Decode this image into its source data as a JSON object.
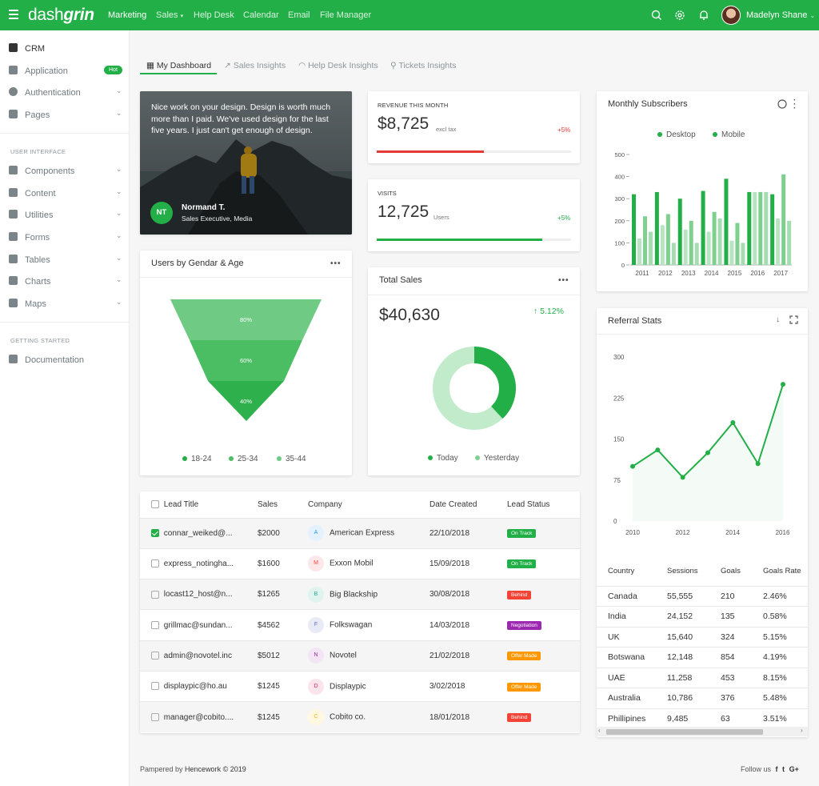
{
  "app": {
    "logo_light": "dash",
    "logo_bold": "grin"
  },
  "topnav": {
    "items": [
      {
        "label": "Marketing",
        "active": true
      },
      {
        "label": "Sales",
        "caret": "▾"
      },
      {
        "label": "Help Desk"
      },
      {
        "label": "Calendar"
      },
      {
        "label": "Email"
      },
      {
        "label": "File Manager"
      }
    ],
    "user_name": "Madelyn Shane",
    "user_caret": "⌄"
  },
  "sidebar": {
    "items": [
      {
        "label": "CRM",
        "icon": "chart-icon",
        "active": true
      },
      {
        "label": "Application",
        "icon": "app-icon",
        "badge": "Hot"
      },
      {
        "label": "Authentication",
        "icon": "user-icon",
        "chevron": "⌄"
      },
      {
        "label": "Pages",
        "icon": "page-icon",
        "chevron": "⌄"
      }
    ],
    "section_ui": "USER INTERFACE",
    "ui_items": [
      {
        "label": "Components",
        "icon": "components-icon",
        "chevron": "⌄"
      },
      {
        "label": "Content",
        "icon": "content-icon",
        "chevron": "⌄"
      },
      {
        "label": "Utilities",
        "icon": "utilities-icon",
        "chevron": "⌄"
      },
      {
        "label": "Forms",
        "icon": "forms-icon",
        "chevron": "⌄"
      },
      {
        "label": "Tables",
        "icon": "tables-icon",
        "chevron": "⌄"
      },
      {
        "label": "Charts",
        "icon": "charts-icon",
        "chevron": "⌄"
      },
      {
        "label": "Maps",
        "icon": "maps-icon",
        "chevron": "⌄"
      }
    ],
    "section_start": "GETTING STARTED",
    "start_items": [
      {
        "label": "Documentation",
        "icon": "book-icon"
      }
    ]
  },
  "tabs": [
    {
      "label": "My Dashboard",
      "active": true
    },
    {
      "label": "Sales Insights"
    },
    {
      "label": "Help Desk Insights"
    },
    {
      "label": "Tickets Insights"
    }
  ],
  "testimonial": {
    "quote": "Nice work on your design. Design is worth much more than I paid. We've used design for the last five years. I just can't get enough of design.",
    "initials": "NT",
    "name": "Normand T.",
    "role": "Sales Executive, Media"
  },
  "revenue": {
    "label": "REVENUE THIS MONTH",
    "value": "$8,725",
    "unit": "excl tax",
    "change": "+5%",
    "progress": 0.55
  },
  "visits": {
    "label": "VISITS",
    "value": "12,725",
    "unit": "Users",
    "change": "+5%",
    "progress": 0.85
  },
  "funnel": {
    "title": "Users by Gendar & Age",
    "more": "•••",
    "levels": [
      "80%",
      "60%",
      "40%"
    ],
    "legend": [
      "18-24",
      "25-34",
      "35-44"
    ]
  },
  "total_sales": {
    "title": "Total Sales",
    "more": "•••",
    "value": "$40,630",
    "change": "5.12%",
    "change_arrow": "↑",
    "legend": [
      "Today",
      "Yesterday"
    ],
    "today_share": 0.38
  },
  "leads": {
    "headers": [
      "Lead Title",
      "Sales",
      "Company",
      "Date Created",
      "Lead Status"
    ],
    "rows": [
      {
        "title": "connar_weiked@...",
        "sales": "$2000",
        "initial": "A",
        "company": "American Express",
        "date": "22/10/2018",
        "status": "On Track",
        "checked": true
      },
      {
        "title": "express_notingha...",
        "sales": "$1600",
        "initial": "M",
        "company": "Exxon Mobil",
        "date": "15/09/2018",
        "status": "On Track"
      },
      {
        "title": "locast12_host@n...",
        "sales": "$1265",
        "initial": "B",
        "company": "Big Blackship",
        "date": "30/08/2018",
        "status": "Behind"
      },
      {
        "title": "grillmac@sundan...",
        "sales": "$4562",
        "initial": "F",
        "company": "Folkswagan",
        "date": "14/03/2018",
        "status": "Negotiation"
      },
      {
        "title": "admin@novotel.inc",
        "sales": "$5012",
        "initial": "N",
        "company": "Novotel",
        "date": "21/02/2018",
        "status": "Offer Made"
      },
      {
        "title": "displaypic@ho.au",
        "sales": "$1245",
        "initial": "D",
        "company": "Displaypic",
        "date": "3/02/2018",
        "status": "Offer Made"
      },
      {
        "title": "manager@cobito....",
        "sales": "$1245",
        "initial": "C",
        "company": "Cobito co.",
        "date": "18/01/2018",
        "status": "Behind"
      }
    ]
  },
  "status_colors": {
    "On Track": "#22af47",
    "Behind": "#f44336",
    "Negotiation": "#9c27b0",
    "Offer Made": "#ff9800"
  },
  "avatar_colors": {
    "A": "#e3f2fd",
    "M": "#fde7e9",
    "B": "#e0f4ef",
    "F": "#e8eaf6",
    "N": "#f3e5f5",
    "D": "#fce4ec",
    "C": "#fff8e1"
  },
  "avatar_text_colors": {
    "A": "#2196f3",
    "M": "#f44336",
    "B": "#26a69a",
    "F": "#5c6bc0",
    "N": "#9c27b0",
    "D": "#e91e63",
    "C": "#ffb300"
  },
  "subscribers": {
    "title": "Monthly Subscribers",
    "chart_data": {
      "type": "bar",
      "categories": [
        "2011",
        "",
        "2012",
        "",
        "2013",
        "",
        "2014",
        "",
        "2015",
        "",
        "2016",
        "",
        "2017"
      ],
      "series": [
        {
          "name": "Desktop",
          "color": "#22af47",
          "values": [
            320,
            330,
            300,
            335,
            390,
            330,
            320
          ]
        },
        {
          "name": "Mobile",
          "color": "#7fd08f",
          "values": [
            220,
            230,
            200,
            240,
            190,
            330,
            410
          ]
        }
      ],
      "extra_light": [
        120,
        180,
        160,
        150,
        110,
        330,
        210
      ],
      "extra_light2": [
        150,
        100,
        100,
        210,
        100,
        330,
        200
      ],
      "yticks": [
        "0",
        "100",
        "200",
        "300",
        "400",
        "500"
      ],
      "xticks": [
        "2011",
        "2012",
        "2013",
        "2014",
        "2015",
        "2016",
        "2017"
      ],
      "ylim": [
        0,
        500
      ]
    }
  },
  "referral": {
    "title": "Referral Stats",
    "chart_data": {
      "type": "area",
      "x": [
        2010,
        2010.5,
        2011,
        2011.5,
        2012,
        2012.5,
        2013,
        2013.5,
        2014
      ],
      "values": [
        100,
        130,
        80,
        125,
        180,
        105,
        250
      ],
      "yticks": [
        "0",
        "75",
        "150",
        "225",
        "300"
      ],
      "xticks": [
        "2010",
        "2012",
        "2014",
        "2016"
      ],
      "ylim": [
        0,
        300
      ]
    },
    "headers": [
      "Country",
      "Sessions",
      "Goals",
      "Goals Rate"
    ],
    "rows": [
      [
        "Canada",
        "55,555",
        "210",
        "2.46%"
      ],
      [
        "India",
        "24,152",
        "135",
        "0.58%"
      ],
      [
        "UK",
        "15,640",
        "324",
        "5.15%"
      ],
      [
        "Botswana",
        "12,148",
        "854",
        "4.19%"
      ],
      [
        "UAE",
        "11,258",
        "453",
        "8.15%"
      ],
      [
        "Australia",
        "10,786",
        "376",
        "5.48%"
      ],
      [
        "Phillipines",
        "9,485",
        "63",
        "3.51%"
      ]
    ]
  },
  "footer": {
    "left_prefix": "Pampered by",
    "left_brand": "Hencework © 2019",
    "right": "Follow us",
    "social": [
      "f",
      "t",
      "G+"
    ]
  }
}
